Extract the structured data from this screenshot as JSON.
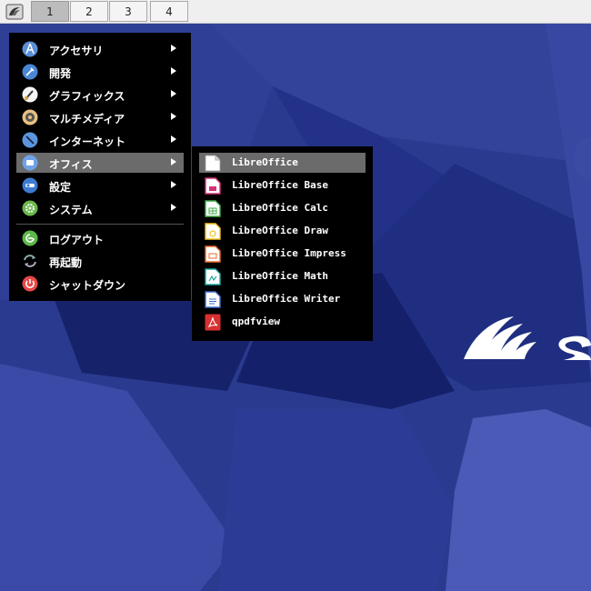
{
  "taskbar": {
    "launcher_icon": "app-menu-icon",
    "workspaces": [
      "1",
      "2",
      "3",
      "4"
    ],
    "active_workspace": "1"
  },
  "main_menu": {
    "items": [
      {
        "label": "アクセサリ",
        "icon": "accessories-icon",
        "submenu": true
      },
      {
        "label": "開発",
        "icon": "development-icon",
        "submenu": true
      },
      {
        "label": "グラフィックス",
        "icon": "graphics-icon",
        "submenu": true
      },
      {
        "label": "マルチメディア",
        "icon": "multimedia-icon",
        "submenu": true
      },
      {
        "label": "インターネット",
        "icon": "internet-icon",
        "submenu": true
      },
      {
        "label": "オフィス",
        "icon": "office-icon",
        "submenu": true,
        "selected": true
      },
      {
        "label": "設定",
        "icon": "settings-icon",
        "submenu": true
      },
      {
        "label": "システム",
        "icon": "system-icon",
        "submenu": true
      },
      {
        "label": "ログアウト",
        "icon": "logout-icon"
      },
      {
        "label": "再起動",
        "icon": "reboot-icon"
      },
      {
        "label": "シャットダウン",
        "icon": "shutdown-icon"
      }
    ]
  },
  "office_submenu": {
    "items": [
      {
        "label": "LibreOffice",
        "icon": "libreoffice-icon",
        "selected": true
      },
      {
        "label": "LibreOffice Base",
        "icon": "libreoffice-base-icon"
      },
      {
        "label": "LibreOffice Calc",
        "icon": "libreoffice-calc-icon"
      },
      {
        "label": "LibreOffice Draw",
        "icon": "libreoffice-draw-icon"
      },
      {
        "label": "LibreOffice Impress",
        "icon": "libreoffice-impress-icon"
      },
      {
        "label": "LibreOffice Math",
        "icon": "libreoffice-math-icon"
      },
      {
        "label": "LibreOffice Writer",
        "icon": "libreoffice-writer-icon"
      },
      {
        "label": "qpdfview",
        "icon": "pdf-viewer-icon"
      }
    ]
  },
  "colors": {
    "desktop_bg": "#2a3a8f",
    "menu_bg": "#000000",
    "menu_highlight": "#6b6b6b",
    "taskbar_bg": "#efefef"
  }
}
